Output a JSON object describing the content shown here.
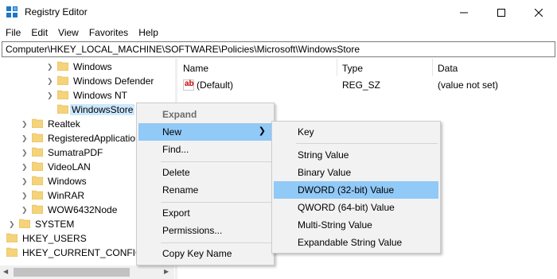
{
  "window": {
    "title": "Registry Editor"
  },
  "menubar": {
    "items": [
      "File",
      "Edit",
      "View",
      "Favorites",
      "Help"
    ]
  },
  "address": {
    "path": "Computer\\HKEY_LOCAL_MACHINE\\SOFTWARE\\Policies\\Microsoft\\WindowsStore"
  },
  "tree": {
    "items": [
      {
        "label": "Windows"
      },
      {
        "label": "Windows Defender"
      },
      {
        "label": "Windows NT"
      },
      {
        "label": "WindowsStore"
      },
      {
        "label": "Realtek"
      },
      {
        "label": "RegisteredApplications"
      },
      {
        "label": "SumatraPDF"
      },
      {
        "label": "VideoLAN"
      },
      {
        "label": "Windows"
      },
      {
        "label": "WinRAR"
      },
      {
        "label": "WOW6432Node"
      },
      {
        "label": "SYSTEM"
      },
      {
        "label": "HKEY_USERS"
      },
      {
        "label": "HKEY_CURRENT_CONFIG"
      }
    ]
  },
  "list": {
    "columns": [
      "Name",
      "Type",
      "Data"
    ],
    "rows": [
      {
        "name": "(Default)",
        "type": "REG_SZ",
        "data": "(value not set)",
        "icon": "ab-string-icon"
      }
    ]
  },
  "context_menu": {
    "items": [
      "Expand",
      "New",
      "Find...",
      "Delete",
      "Rename",
      "Export",
      "Permissions...",
      "Copy Key Name"
    ]
  },
  "submenu": {
    "items": [
      "Key",
      "String Value",
      "Binary Value",
      "DWORD (32-bit) Value",
      "QWORD (64-bit) Value",
      "Multi-String Value",
      "Expandable String Value"
    ]
  },
  "colors": {
    "highlight": "#91c9f7",
    "selection": "#cce8ff",
    "folder": "#f5d37a",
    "menu_bg": "#f2f2f2"
  }
}
